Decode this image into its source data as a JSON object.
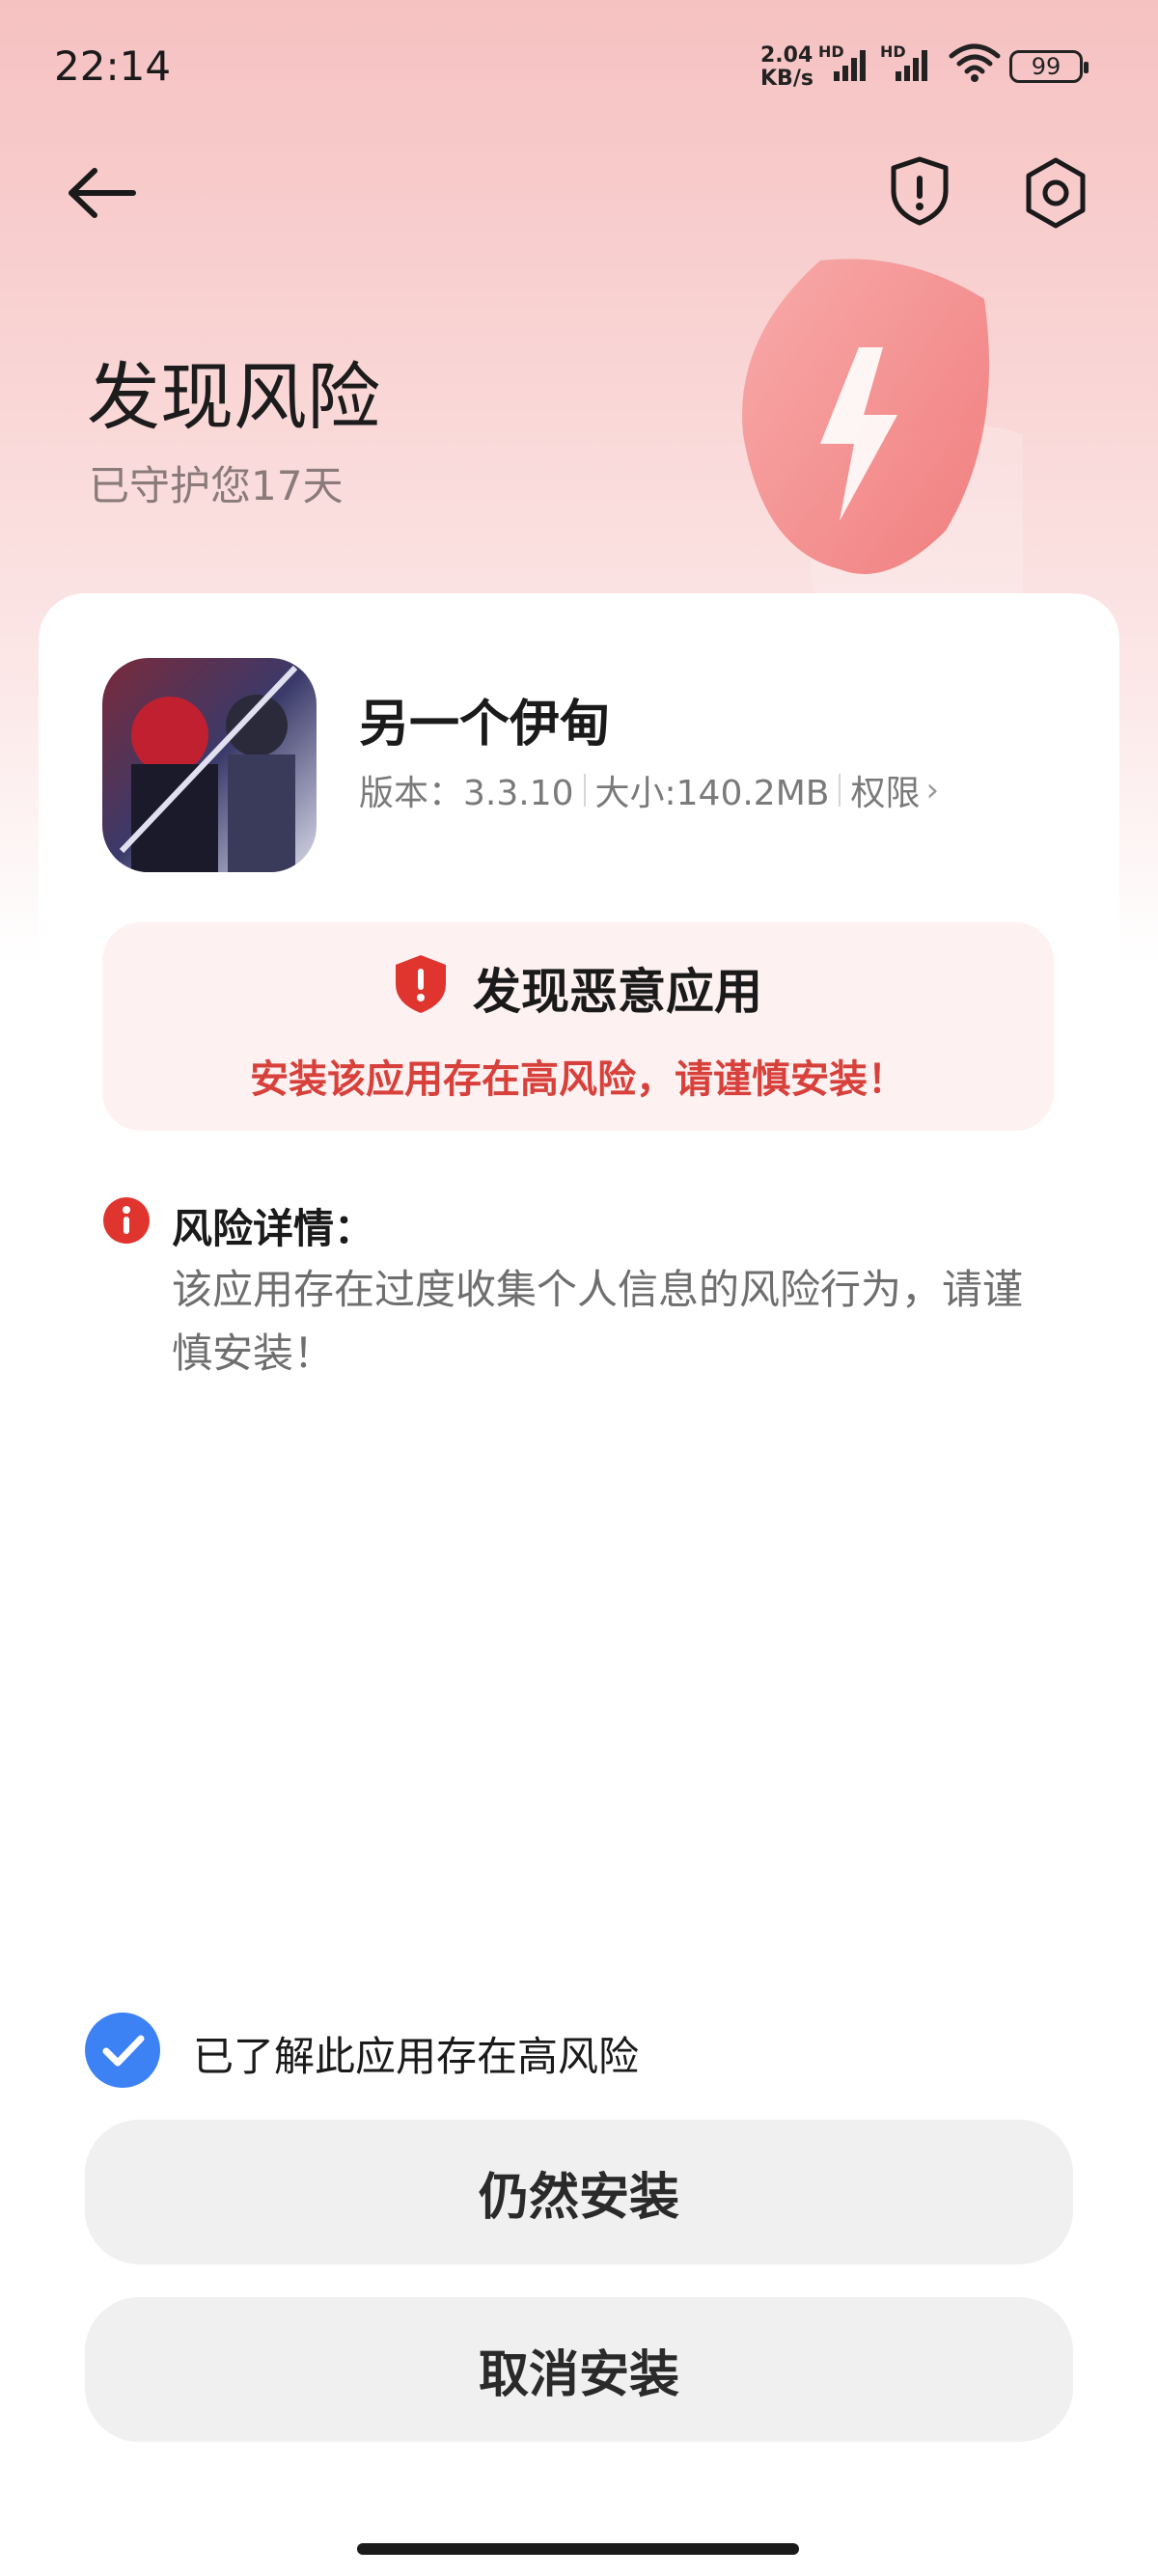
{
  "status_bar": {
    "time": "22:14",
    "net_speed_value": "2.04",
    "net_speed_unit": "KB/s",
    "signal_1_label": "HD",
    "signal_2_label": "HD",
    "battery": "99"
  },
  "nav": {
    "back_icon": "back-arrow-icon",
    "security_icon": "shield-alert-icon",
    "settings_icon": "gear-icon"
  },
  "hero": {
    "title": "发现风险",
    "subtitle": "已守护您17天"
  },
  "app": {
    "name": "另一个伊甸",
    "version": "版本：3.3.10",
    "size": "大小:140.2MB",
    "permission_label": "权限"
  },
  "warning": {
    "title": "发现恶意应用",
    "description": "安装该应用存在高风险，请谨慎安装！"
  },
  "risk_detail": {
    "label": "风险详情：",
    "text": "该应用存在过度收集个人信息的风险行为，请谨慎安装！"
  },
  "acknowledge": {
    "checked": true,
    "label": "已了解此应用存在高风险"
  },
  "buttons": {
    "install_anyway": "仍然安装",
    "cancel_install": "取消安装"
  },
  "colors": {
    "accent_blue": "#3d82f5",
    "danger_red": "#d8413b",
    "warning_bg": "#fdf1f1",
    "button_bg": "#f0f0f0"
  }
}
